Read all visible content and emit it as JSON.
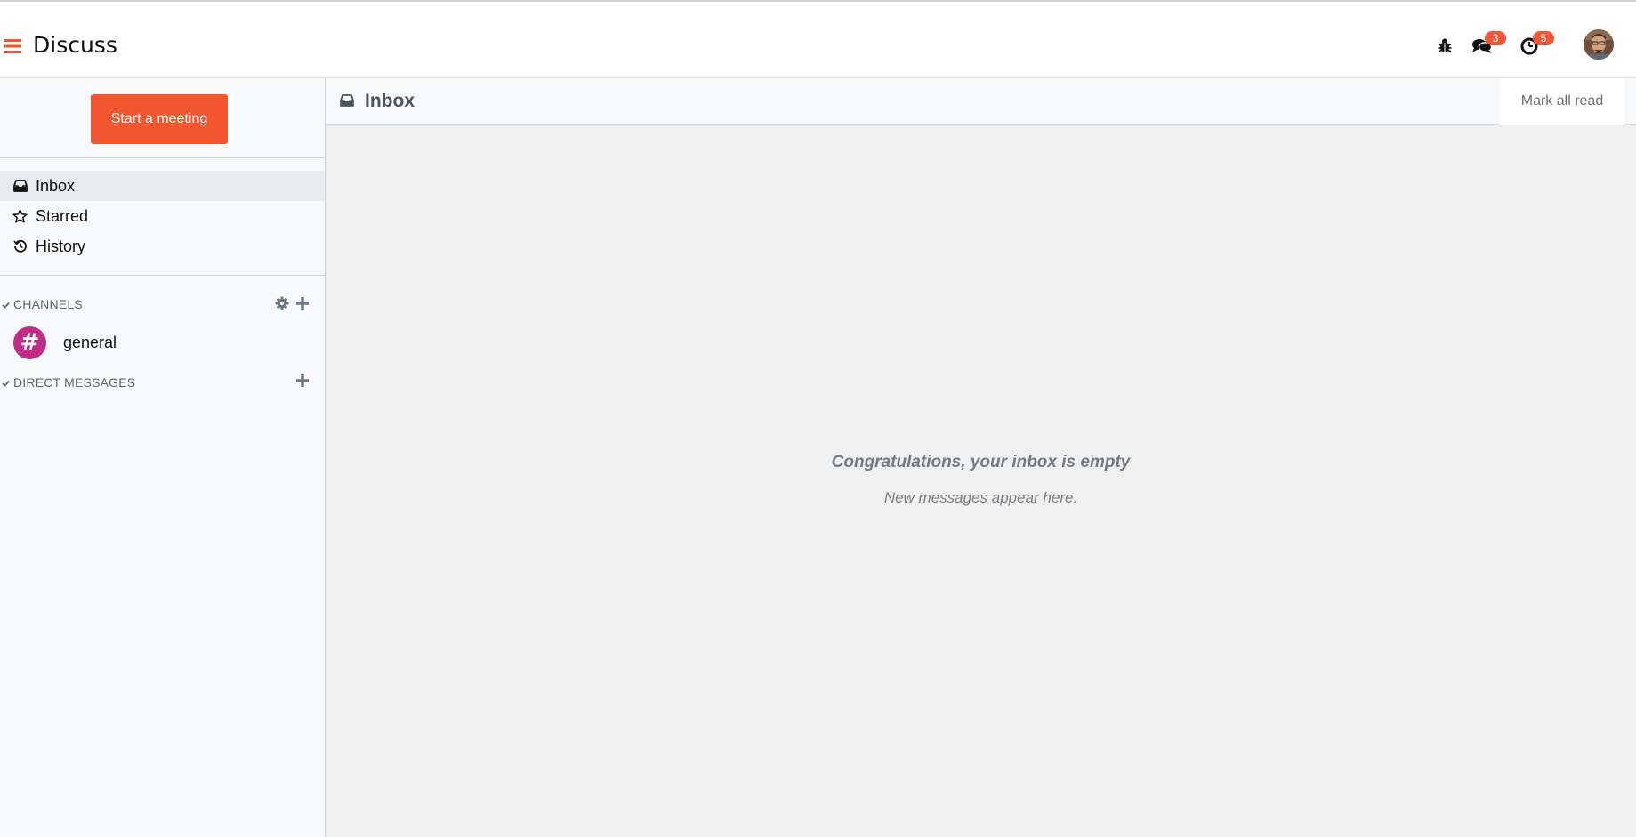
{
  "app": {
    "title": "Discuss",
    "accent_color": "#f2562f"
  },
  "systray": {
    "debug_icon": "bug-icon",
    "messages": {
      "icon": "chat-bubbles-icon",
      "count": "3"
    },
    "activities": {
      "icon": "clock-icon",
      "count": "5"
    },
    "user_avatar": "user-avatar"
  },
  "sidebar": {
    "start_meeting_label": "Start a meeting",
    "mailboxes": [
      {
        "label": "Inbox",
        "icon": "inbox-icon",
        "active": true
      },
      {
        "label": "Starred",
        "icon": "star-icon",
        "active": false
      },
      {
        "label": "History",
        "icon": "history-icon",
        "active": false
      }
    ],
    "categories": {
      "channels": {
        "label": "CHANNELS",
        "items": [
          {
            "name": "general",
            "avatar_color": "#c12c86",
            "glyph": "#"
          }
        ]
      },
      "direct_messages": {
        "label": "DIRECT MESSAGES"
      }
    }
  },
  "main": {
    "header_title": "Inbox",
    "mark_all_read_label": "Mark all read",
    "empty_title": "Congratulations, your inbox is empty",
    "empty_subtitle": "New messages appear here."
  }
}
